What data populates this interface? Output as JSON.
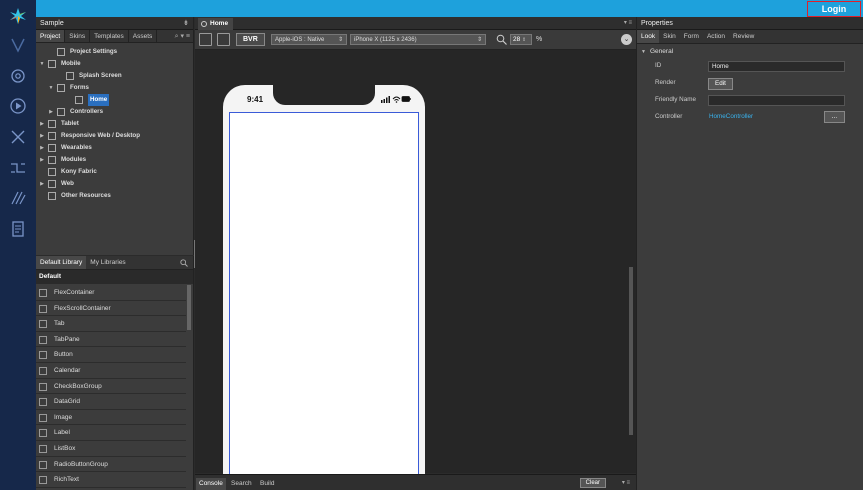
{
  "topbar": {
    "login_label": "Login",
    "color": "#1ea1dc"
  },
  "rail": {
    "icons": [
      "brand-logo-icon",
      "vertical-icon",
      "settings-icon",
      "play-icon",
      "tools-icon",
      "integration-icon",
      "design-icon",
      "document-icon"
    ]
  },
  "project_panel": {
    "title": "Sample",
    "tabs": [
      "Project",
      "Skins",
      "Templates",
      "Assets"
    ],
    "tree": [
      {
        "label": "Project Settings",
        "depth": 1,
        "arrow": "",
        "icon": "settings-doc-icon"
      },
      {
        "label": "Mobile",
        "depth": 0,
        "arrow": "▼",
        "icon": "mobile-icon"
      },
      {
        "label": "Splash Screen",
        "depth": 2,
        "arrow": "",
        "icon": "splash-icon"
      },
      {
        "label": "Forms",
        "depth": 1,
        "arrow": "▼",
        "icon": "folder-icon"
      },
      {
        "label": "Home",
        "depth": 3,
        "arrow": "",
        "icon": "form-icon",
        "selected": true
      },
      {
        "label": "Controllers",
        "depth": 1,
        "arrow": "▶",
        "icon": "folder-icon"
      },
      {
        "label": "Tablet",
        "depth": 0,
        "arrow": "▶",
        "icon": "tablet-icon"
      },
      {
        "label": "Responsive Web / Desktop",
        "depth": 0,
        "arrow": "▶",
        "icon": "desktop-icon"
      },
      {
        "label": "Wearables",
        "depth": 0,
        "arrow": "▶",
        "icon": "watch-icon"
      },
      {
        "label": "Modules",
        "depth": 0,
        "arrow": "▶",
        "icon": "folder-icon"
      },
      {
        "label": "Kony Fabric",
        "depth": 0,
        "arrow": "",
        "icon": "fabric-icon"
      },
      {
        "label": "Web",
        "depth": 0,
        "arrow": "▶",
        "icon": "globe-icon"
      },
      {
        "label": "Other Resources",
        "depth": 0,
        "arrow": "",
        "icon": "folder-icon"
      }
    ]
  },
  "library_panel": {
    "tabs": [
      "Default Library",
      "My Libraries"
    ],
    "section": "Default",
    "items": [
      "FlexContainer",
      "FlexScrollContainer",
      "Tab",
      "TabPane",
      "Button",
      "Calendar",
      "CheckBoxGroup",
      "DataGrid",
      "Image",
      "Label",
      "ListBox",
      "RadioButtonGroup",
      "RichText"
    ]
  },
  "canvas": {
    "tab_label": "Home",
    "bvr_label": "BVR",
    "platform_select": "Apple-iOS : Native",
    "device_select": "iPhone X (1125 x 2436)",
    "zoom_value": "28",
    "zoom_unit": "%",
    "phone_time": "9:41"
  },
  "console_bar": {
    "tabs": [
      "Console",
      "Search",
      "Build"
    ],
    "clear_label": "Clear"
  },
  "properties": {
    "title": "Properties",
    "tabs": [
      "Look",
      "Skin",
      "Form",
      "Action",
      "Review"
    ],
    "section": "General",
    "id_label": "ID",
    "id_value": "Home",
    "render_label": "Render",
    "render_button": "Edit",
    "friendly_label": "Friendly Name",
    "friendly_value": "",
    "controller_label": "Controller",
    "controller_value": "HomeController",
    "more_button": "..."
  }
}
